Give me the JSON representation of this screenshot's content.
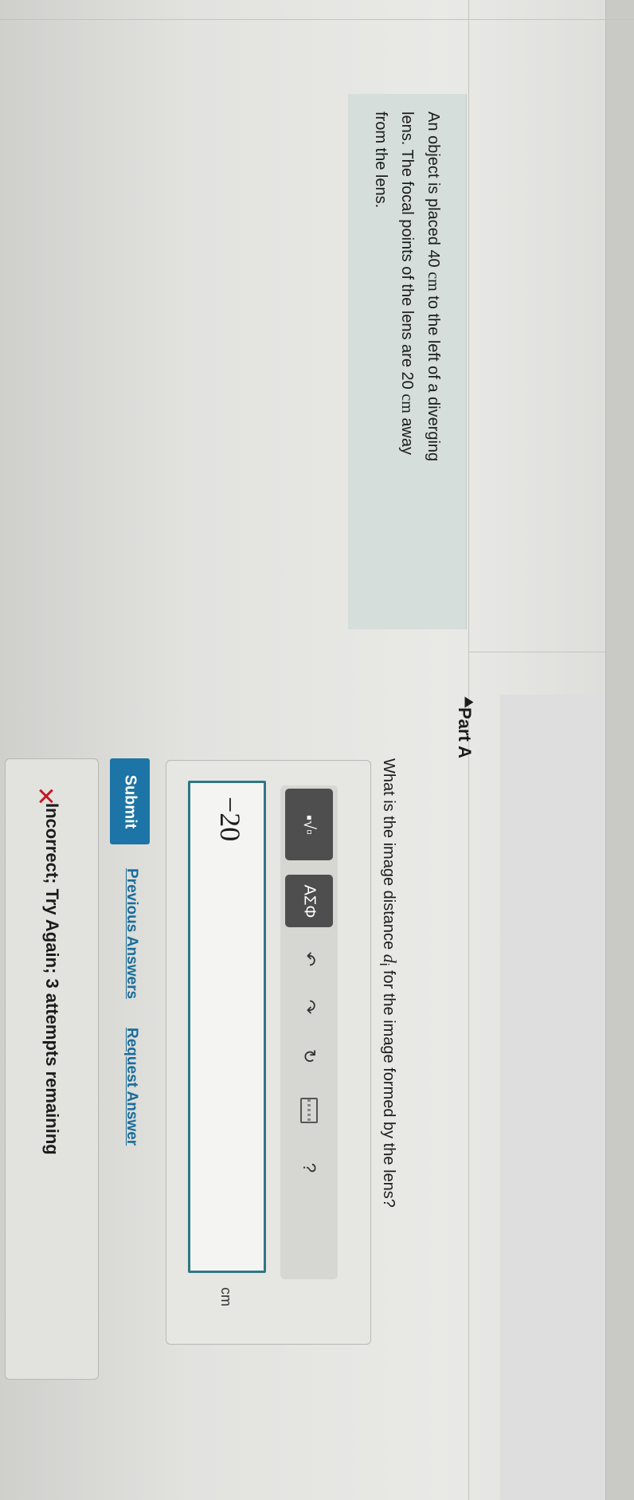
{
  "problem": {
    "line1_pre": "An object is placed 40",
    "unit1": "cm",
    "line1_post": "to the left of a diverging",
    "line2_pre": "lens. The focal points of the lens are 20",
    "unit2": "cm",
    "line2_post": "away",
    "line3": "from the lens."
  },
  "part": {
    "title": "Part A",
    "question_pre": "What is the image distance",
    "question_var": "d",
    "question_sub": "i",
    "question_post": "for the image formed by the lens?"
  },
  "toolbar": {
    "templates_label": "▪√▫",
    "symbols_label": "ΑΣΦ",
    "undo_icon": "undo-icon",
    "redo_icon": "redo-icon",
    "reset_icon": "reset-icon",
    "keyboard_icon": "keyboard-icon",
    "help_label": "?"
  },
  "answer": {
    "value": "−20",
    "unit": "cm"
  },
  "actions": {
    "submit_label": "Submit",
    "previous_answers_label": "Previous Answers",
    "request_answer_label": "Request Answer"
  },
  "feedback": {
    "icon": "x-icon",
    "text": "Incorrect; Try Again; 3 attempts remaining"
  },
  "colors": {
    "accent": "#1c75a6",
    "input_border": "#2f7784",
    "error": "#c7161d",
    "problem_bg": "#d5dedb"
  }
}
